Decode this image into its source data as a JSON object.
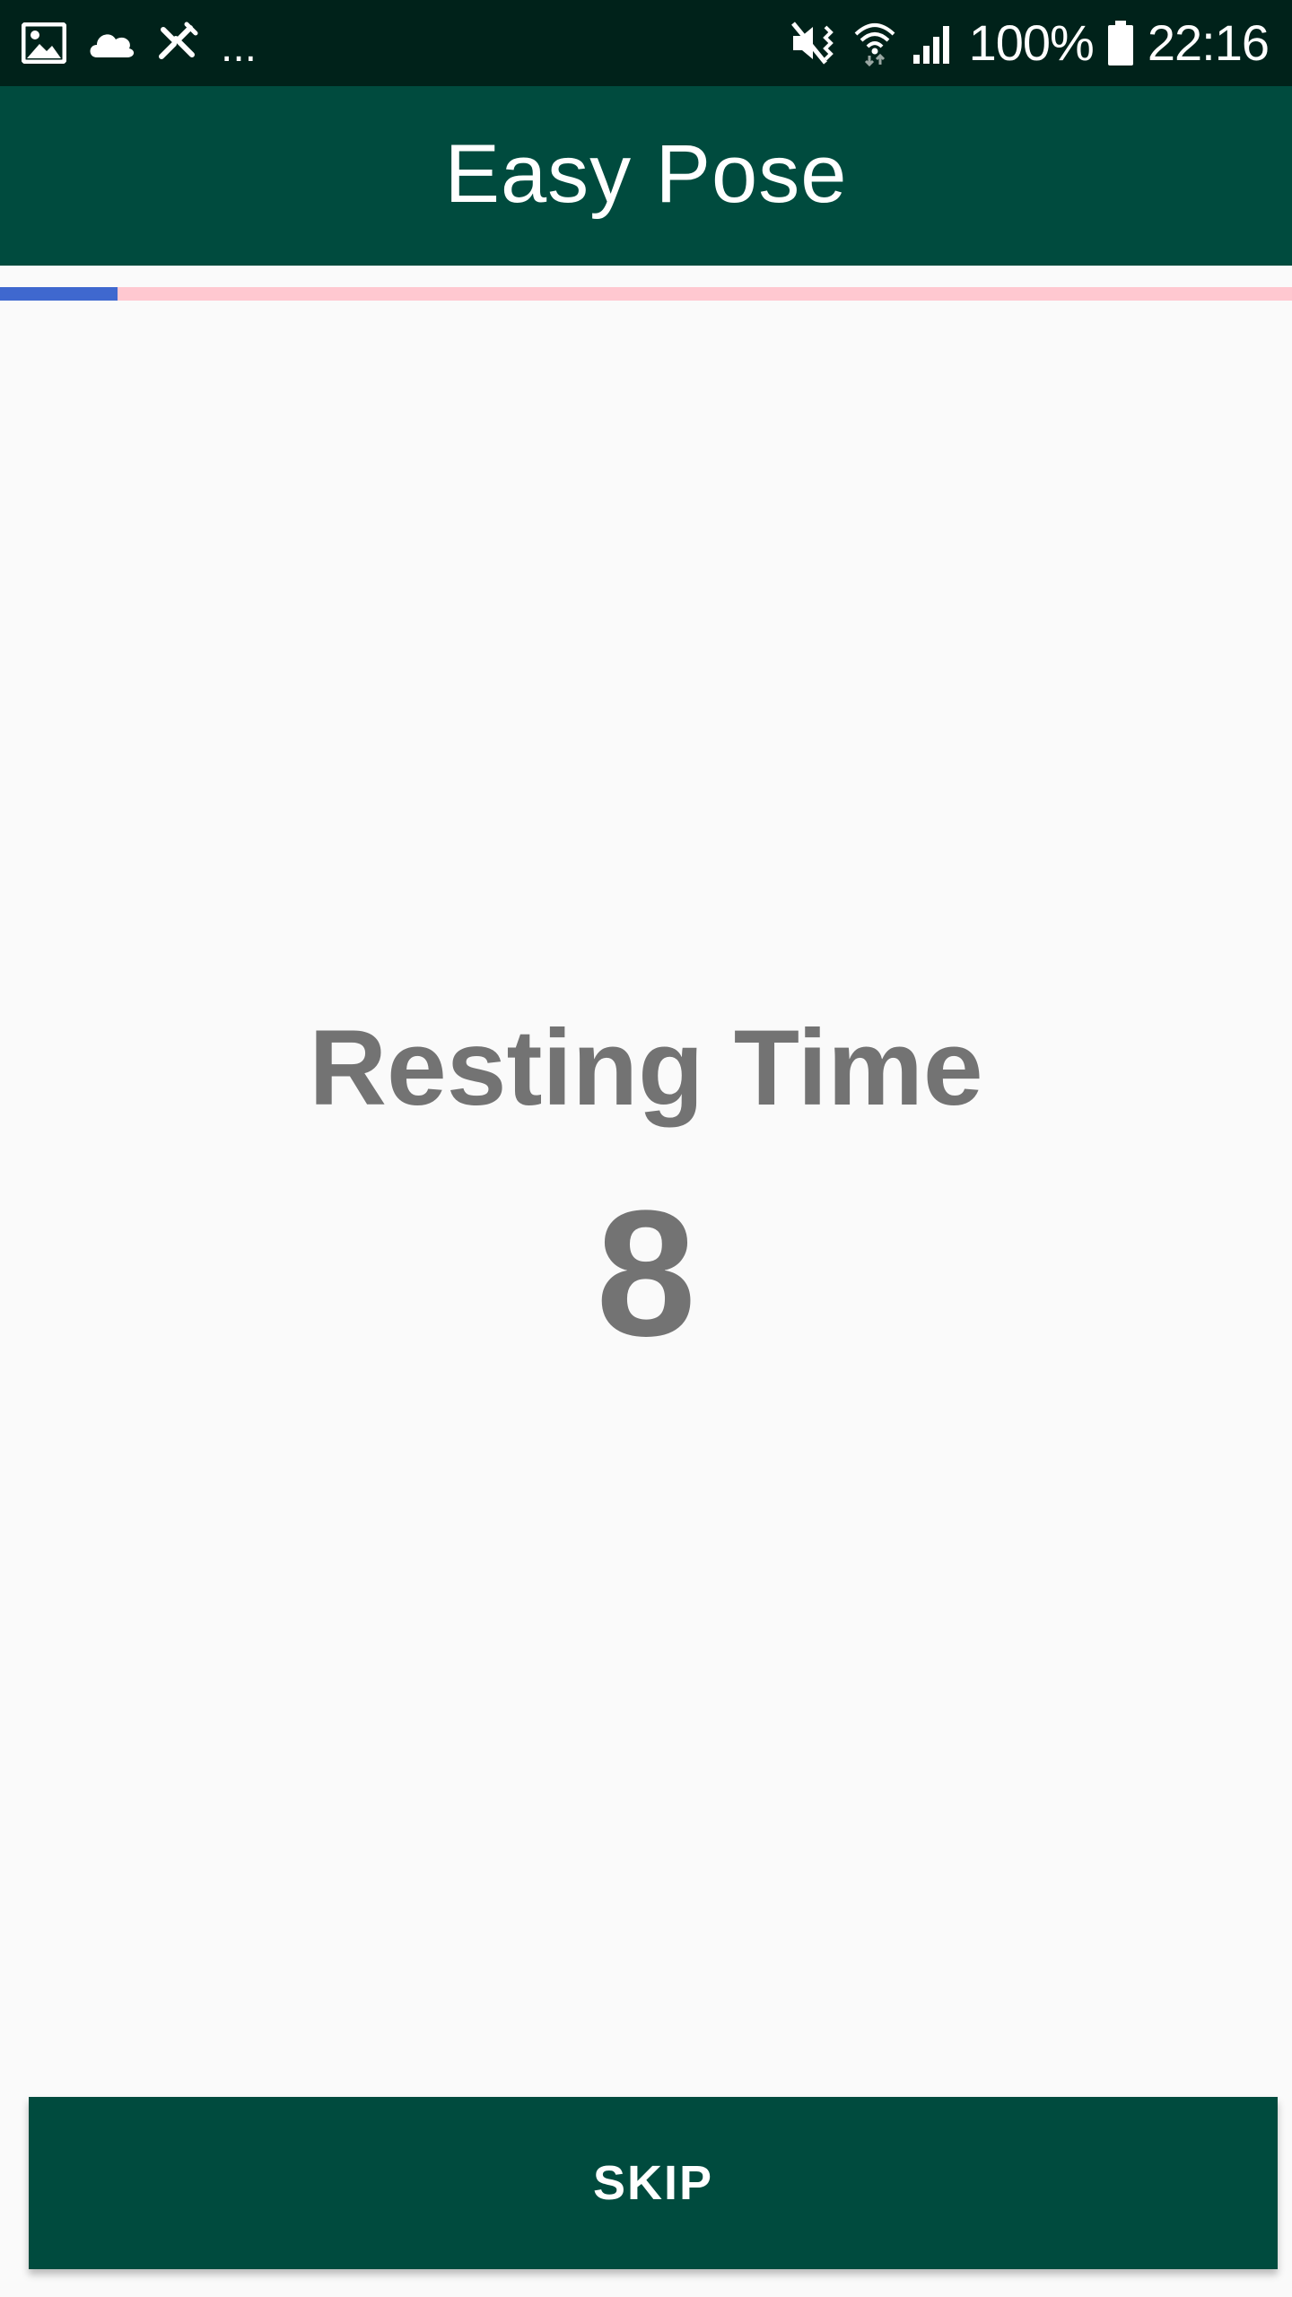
{
  "status_bar": {
    "left_icons": [
      "gallery-icon",
      "cloud-icon",
      "wrench-icon"
    ],
    "more_indicator": "...",
    "right_icons": [
      "mute-vibrate-icon",
      "wifi-icon",
      "signal-icon",
      "battery-icon"
    ],
    "battery_percent": "100%",
    "time": "22:16"
  },
  "app_bar": {
    "title": "Easy Pose"
  },
  "progress": {
    "fraction": 0.091,
    "fill_color": "#3f68cf",
    "track_color": "#ffc8d0"
  },
  "main": {
    "label": "Resting Time",
    "countdown": "8"
  },
  "actions": {
    "skip_label": "SKIP"
  },
  "colors": {
    "primary": "#004b3e",
    "status_bar": "#00221a",
    "text_muted": "#737373",
    "background": "#fafafa"
  }
}
